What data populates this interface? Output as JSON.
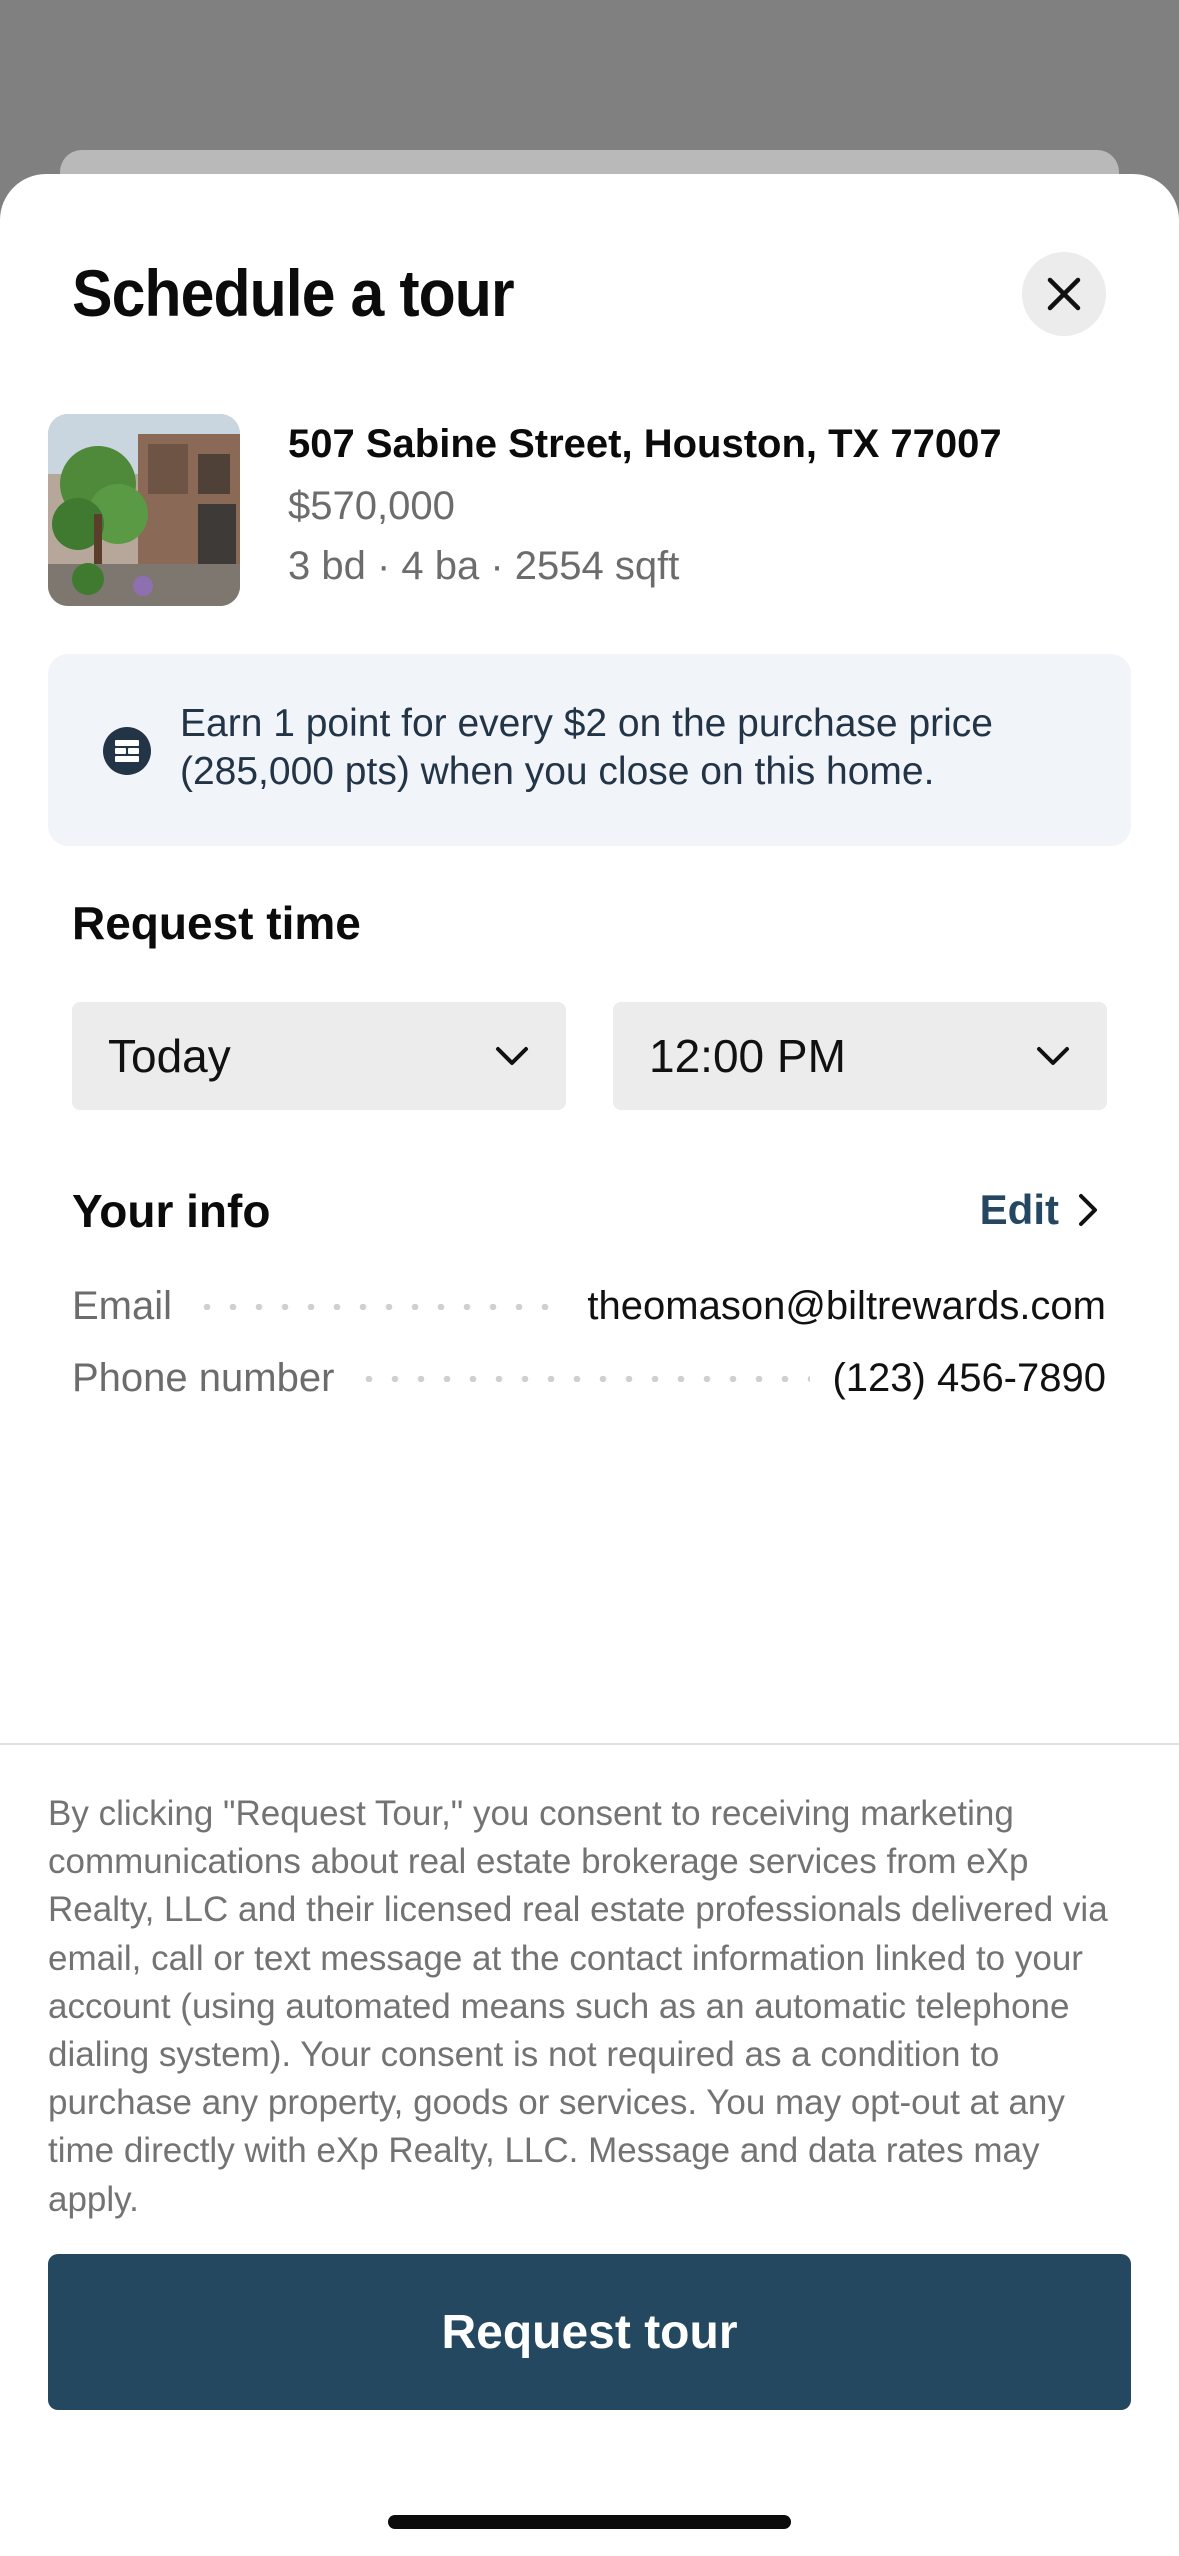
{
  "modal": {
    "title": "Schedule a tour",
    "close_icon": "close-icon"
  },
  "listing": {
    "address": "507 Sabine Street, Houston, TX 77007",
    "price": "$570,000",
    "specs": "3 bd · 4 ba · 2554 sqft"
  },
  "rewards": {
    "icon": "bilt-logo-icon",
    "text": "Earn 1 point for every $2 on the purchase price (285,000 pts) when you close on this home."
  },
  "request_time": {
    "label": "Request time",
    "date_value": "Today",
    "time_value": "12:00 PM"
  },
  "your_info": {
    "label": "Your info",
    "edit_label": "Edit",
    "email_key": "Email",
    "email_value": "theomason@biltrewards.com",
    "phone_key": "Phone number",
    "phone_value": "(123) 456-7890"
  },
  "disclaimer": "By clicking \"Request Tour,\" you consent to receiving marketing communications about real estate brokerage services from eXp Realty, LLC and their licensed real estate professionals delivered via email, call or text message at the contact information linked to your account (using automated means such as an automatic telephone dialing system). Your consent is not required as a condition to purchase any property, goods or services. You may opt-out at any time directly with eXp Realty, LLC. Message and data rates may apply.",
  "cta": {
    "label": "Request tour",
    "color": "#254861"
  }
}
